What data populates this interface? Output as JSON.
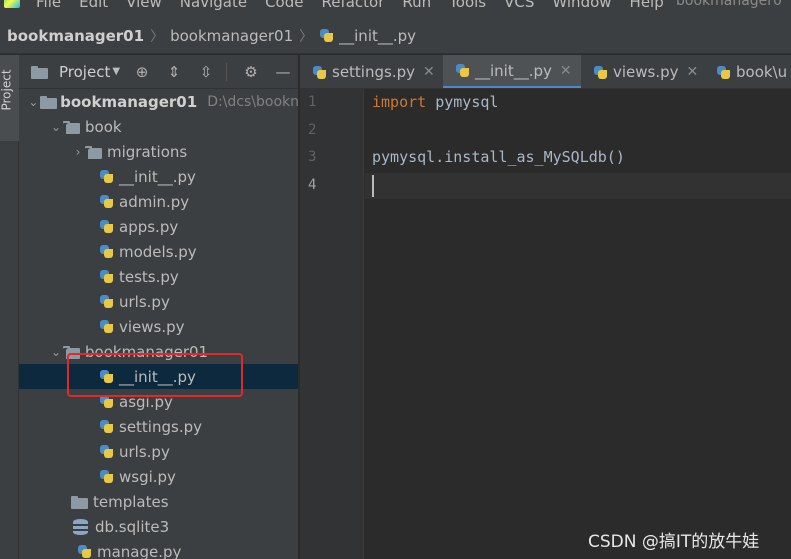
{
  "menu": {
    "items": [
      "File",
      "Edit",
      "View",
      "Navigate",
      "Code",
      "Refactor",
      "Run",
      "Tools",
      "VCS",
      "Window",
      "Help"
    ],
    "window_title": "bookmanager0"
  },
  "breadcrumb": {
    "root": "bookmanager01",
    "folder": "bookmanager01",
    "file": "__init__.py"
  },
  "side_strip": {
    "project_tab": "Project"
  },
  "project_panel": {
    "title": "Project",
    "tree": [
      {
        "label": "bookmanager01",
        "path": "D:\\dcs\\bookn"
      },
      {
        "label": "book"
      },
      {
        "label": "migrations"
      },
      {
        "label": "__init__.py"
      },
      {
        "label": "admin.py"
      },
      {
        "label": "apps.py"
      },
      {
        "label": "models.py"
      },
      {
        "label": "tests.py"
      },
      {
        "label": "urls.py"
      },
      {
        "label": "views.py"
      },
      {
        "label": "bookmanager01"
      },
      {
        "label": "__init__.py"
      },
      {
        "label": "asgi.py"
      },
      {
        "label": "settings.py"
      },
      {
        "label": "urls.py"
      },
      {
        "label": "wsgi.py"
      },
      {
        "label": "templates"
      },
      {
        "label": "db.sqlite3"
      },
      {
        "label": "manage.py"
      }
    ]
  },
  "editor": {
    "tabs": [
      {
        "label": "settings.py"
      },
      {
        "label": "__init__.py"
      },
      {
        "label": "views.py"
      },
      {
        "label": "book\\u"
      }
    ],
    "line_numbers": [
      "1",
      "2",
      "3",
      "4"
    ],
    "code": {
      "line1_keyword": "import",
      "line1_rest": " pymysql",
      "line3": "pymysql.install_as_MySQLdb()"
    }
  },
  "watermark": "CSDN @搞IT的放牛娃"
}
